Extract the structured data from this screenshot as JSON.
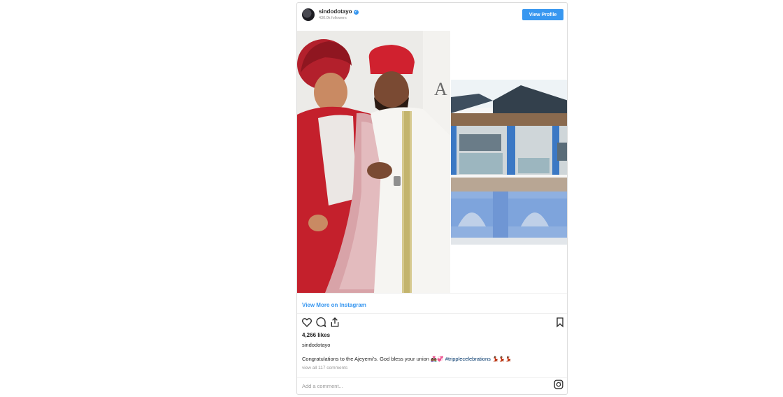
{
  "post": {
    "username": "sindodotayo",
    "followers": "430.0k followers",
    "view_profile_label": "View Profile",
    "view_more_label": "View More on Instagram",
    "likes": "4,266 likes",
    "owner": "sindodotayo",
    "caption": "Congratulations to the Ajeyemi's. God bless your union",
    "hashtag": "#tripplecelebrations",
    "view_comments": "view all 117 comments",
    "add_comment_placeholder": "Add a comment..."
  },
  "icons": {
    "verified": "verified-badge-icon",
    "like": "heart-icon",
    "comment": "comment-icon",
    "share": "share-icon",
    "save": "bookmark-icon",
    "instagram": "instagram-icon"
  },
  "colors": {
    "accent": "#3897f0",
    "hashtag": "#003569",
    "muted": "#999999"
  }
}
